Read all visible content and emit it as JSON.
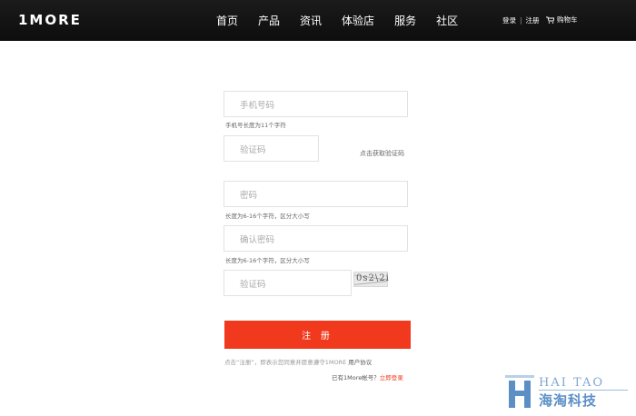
{
  "header": {
    "logo": "1MORE",
    "nav": [
      "首页",
      "产品",
      "资讯",
      "体验店",
      "服务",
      "社区"
    ],
    "login": "登录",
    "register": "注册",
    "cart": "购物车"
  },
  "form": {
    "phone_placeholder": "手机号码",
    "phone_hint": "手机号长度为11个字符",
    "sms_code_placeholder": "验证码",
    "get_code_link": "点击获取验证码",
    "password_placeholder": "密码",
    "password_hint": "长度为6-16个字符，区分大小写",
    "confirm_placeholder": "确认密码",
    "confirm_hint": "长度为6-16个字符，区分大小写",
    "captcha_placeholder": "验证码",
    "captcha_text": "0s2\\2i",
    "submit_label": "注 册",
    "agree_text": "点击“注册”，即表示您同意并愿意遵守1MORE ",
    "agree_link": "用户协议",
    "have_account_text": "已有1More帐号？",
    "login_link": "立即登录"
  },
  "watermark": {
    "en": "HAI TAO",
    "cn": "海淘科技"
  },
  "colors": {
    "header_bg": "#111111",
    "accent": "#f1391d",
    "watermark": "#5b8fc6"
  }
}
